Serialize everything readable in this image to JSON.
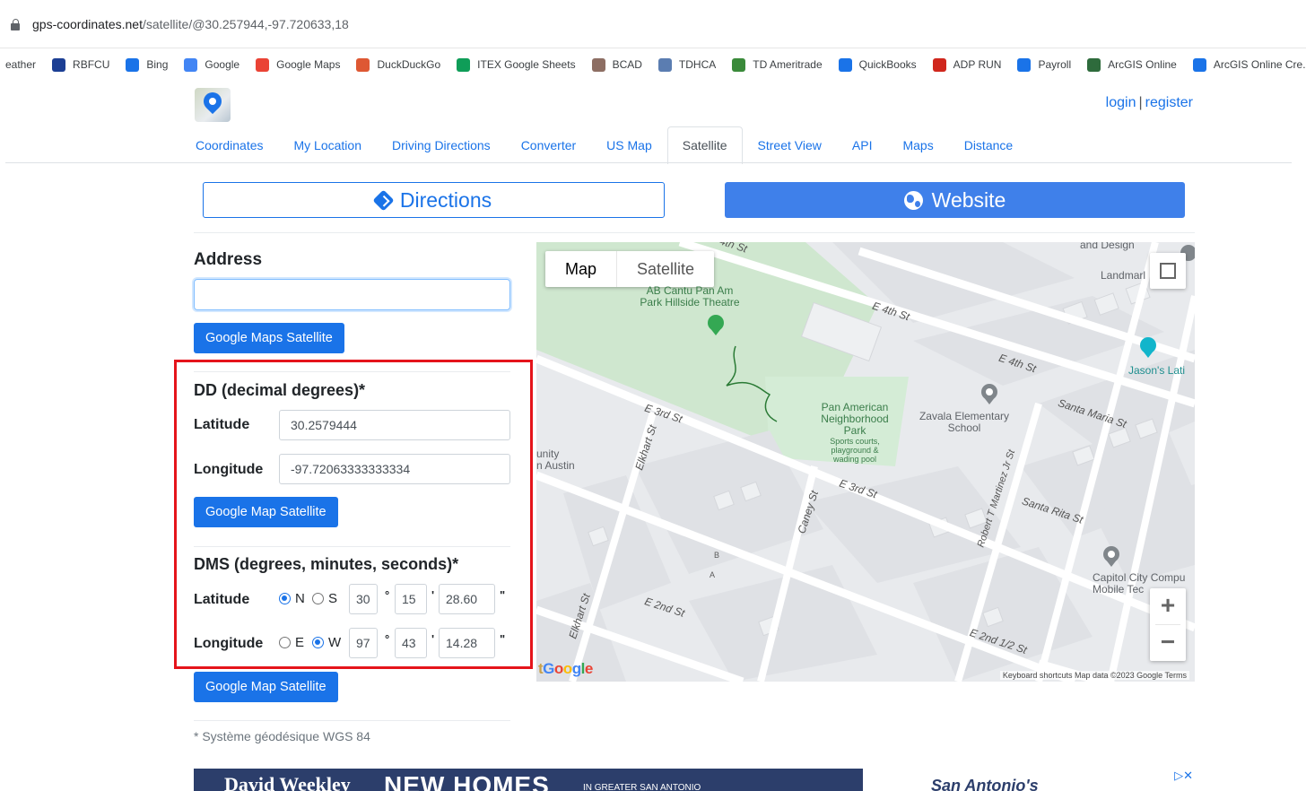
{
  "browser": {
    "url_host": "gps-coordinates.net",
    "url_path": "/satellite/@30.257944,-97.720633,18",
    "bookmarks": [
      {
        "label": "eather",
        "icon": "weather-icon",
        "color": "#ffffff"
      },
      {
        "label": "RBFCU",
        "icon": "rbfcu-icon",
        "color": "#1c3f94"
      },
      {
        "label": "Bing",
        "icon": "bing-search-icon",
        "color": "#1a73e8"
      },
      {
        "label": "Google",
        "icon": "google-icon",
        "color": "#4285f4"
      },
      {
        "label": "Google Maps",
        "icon": "google-maps-pin-icon",
        "color": "#ea4335"
      },
      {
        "label": "DuckDuckGo",
        "icon": "duckduckgo-icon",
        "color": "#de5833"
      },
      {
        "label": "ITEX Google Sheets",
        "icon": "sheets-icon",
        "color": "#0f9d58"
      },
      {
        "label": "BCAD",
        "icon": "bcad-icon",
        "color": "#8d6e63"
      },
      {
        "label": "TDHCA",
        "icon": "tdhca-star-icon",
        "color": "#5b7db1"
      },
      {
        "label": "TD Ameritrade",
        "icon": "td-icon",
        "color": "#3a8a3a"
      },
      {
        "label": "QuickBooks",
        "icon": "quickbooks-icon",
        "color": "#1a73e8"
      },
      {
        "label": "ADP RUN",
        "icon": "adp-icon",
        "color": "#d0271d"
      },
      {
        "label": "Payroll",
        "icon": "payroll-icon",
        "color": "#1a73e8"
      },
      {
        "label": "ArcGIS Online",
        "icon": "arcgis-globe-icon",
        "color": "#2e6b3c"
      },
      {
        "label": "ArcGIS Online Cre...",
        "icon": "esri-icon",
        "color": "#1a73e8"
      }
    ]
  },
  "site": {
    "login": "login",
    "separator": "|",
    "register": "register",
    "nav": [
      "Coordinates",
      "My Location",
      "Driving Directions",
      "Converter",
      "US Map",
      "Satellite",
      "Street View",
      "API",
      "Maps",
      "Distance"
    ],
    "active_tab": "Satellite",
    "directions_label": "Directions",
    "website_label": "Website"
  },
  "form": {
    "address_heading": "Address",
    "address_value": "",
    "address_button": "Google Maps Satellite",
    "dd_heading": "DD (decimal degrees)*",
    "latitude_label": "Latitude",
    "latitude_value": "30.2579444",
    "longitude_label": "Longitude",
    "longitude_value": "-97.72063333333334",
    "dd_button": "Google Map Satellite",
    "dms_heading": "DMS (degrees, minutes, seconds)*",
    "dms_lat_label": "Latitude",
    "dms_lon_label": "Longitude",
    "north": "N",
    "south": "S",
    "east": "E",
    "west": "W",
    "lat_deg": "30",
    "lat_min": "15",
    "lat_sec": "28.60",
    "lon_deg": "97",
    "lon_min": "43",
    "lon_sec": "14.28",
    "deg_symbol": "°",
    "min_symbol": "'",
    "sec_symbol": "\"",
    "dms_button": "Google Map Satellite",
    "footnote": "* Système géodésique WGS 84"
  },
  "map": {
    "toggle_map": "Map",
    "toggle_satellite": "Satellite",
    "zoom_in": "+",
    "zoom_out": "−",
    "labels": {
      "e4th_top": "E 4th St",
      "e4th_right": "E 4th St",
      "e3rd_left": "E 3rd St",
      "e3rd_mid": "E 3rd St",
      "e2nd": "E 2nd St",
      "e2nd_half": "E 2nd 1/2 St",
      "santa_maria": "Santa Maria St",
      "santa_rita": "Santa Rita St",
      "elkhart1": "Elkhart St",
      "elkhart2": "Elkhart St",
      "caney": "Caney St",
      "robert": "Robert T Martinez Jr St",
      "top_4th": "4th St",
      "ab_cantu": "AB Cantu Pan Am",
      "hillside": "Park Hillside Theatre",
      "pan_american": "Pan American",
      "neighborhood": "Neighborhood",
      "park": "Park",
      "park_desc1": "Sports courts,",
      "park_desc2": "playground &",
      "park_desc3": "wading pool",
      "zavala1": "Zavala Elementary",
      "zavala2": "School",
      "jasons": "Jason's Lati",
      "design": "and Design",
      "landmark": "Landmarl",
      "capitol1": "Capitol City Compu",
      "capitol2": "Mobile Tec",
      "unity1": "unity",
      "unity2": "n Austin",
      "b": "B",
      "a": "A"
    },
    "google_logo": "Google",
    "footer": "Keyboard shortcuts    Map data ©2023 Google    Terms"
  },
  "ad": {
    "brand": "David Weekley",
    "headline": "NEW HOMES",
    "sub": "IN GREATER SAN ANTONIO",
    "right": "San Antonio's"
  }
}
